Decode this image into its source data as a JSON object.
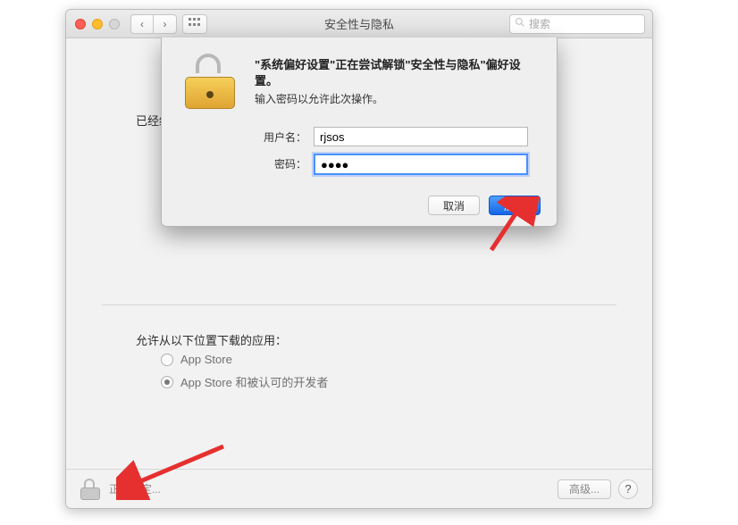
{
  "titlebar": {
    "title": "安全性与隐私",
    "search_placeholder": "搜索"
  },
  "content": {
    "truncated_label": "已经给",
    "allow_from_label": "允许从以下位置下载的应用：",
    "radio_options": [
      {
        "label": "App Store",
        "selected": false
      },
      {
        "label": "App Store 和被认可的开发者",
        "selected": true
      }
    ]
  },
  "footer": {
    "status_text": "正在鉴定...",
    "advanced_label": "高级...",
    "help_label": "?"
  },
  "modal": {
    "title": "\"系统偏好设置\"正在尝试解锁\"安全性与隐私\"偏好设置。",
    "subtitle": "输入密码以允许此次操作。",
    "username_label": "用户名：",
    "username_value": "rjsos",
    "password_label": "密码：",
    "password_value": "●●●●",
    "cancel_label": "取消",
    "unlock_label": "解锁"
  }
}
